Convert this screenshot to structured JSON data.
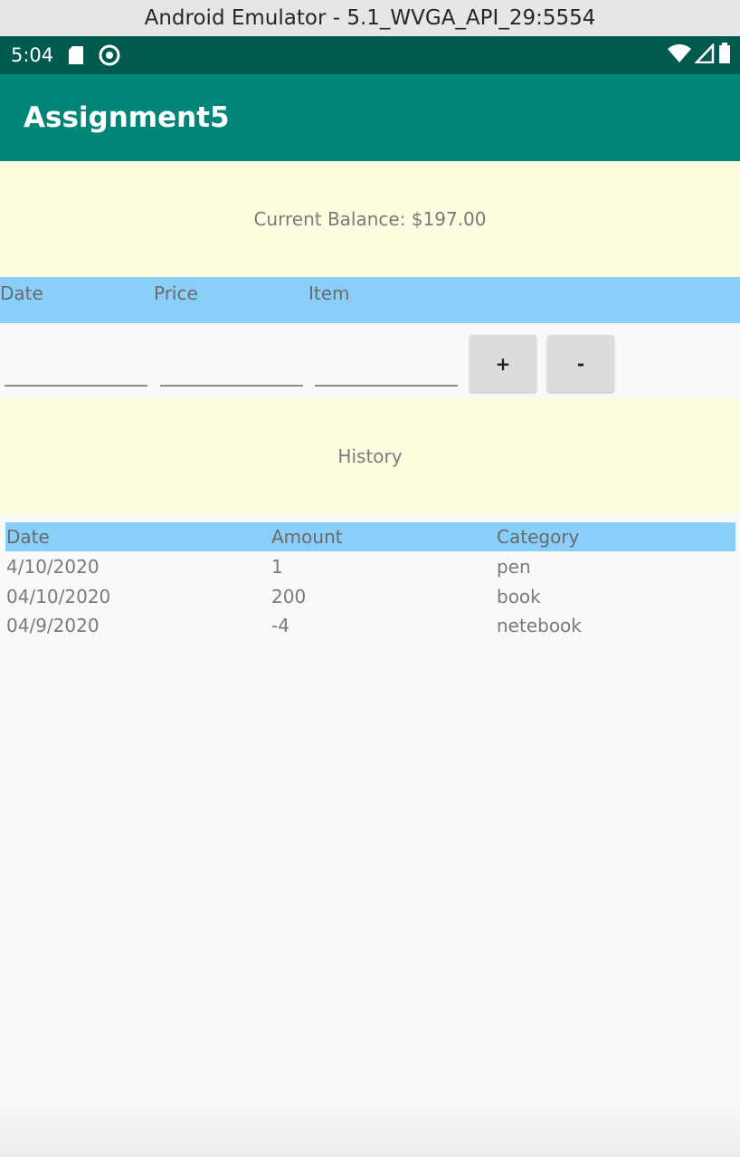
{
  "window": {
    "title": "Android Emulator - 5.1_WVGA_API_29:5554"
  },
  "status_bar": {
    "time": "5:04"
  },
  "app_bar": {
    "title": "Assignment5"
  },
  "balance": {
    "text": "Current Balance: $197.00"
  },
  "input_header": {
    "date": "Date",
    "price": "Price",
    "item": "Item"
  },
  "inputs": {
    "date": "",
    "price": "",
    "item": ""
  },
  "buttons": {
    "add": "+",
    "subtract": "-"
  },
  "history": {
    "title": "History"
  },
  "table": {
    "headers": [
      "Date",
      "Amount",
      "Category"
    ],
    "rows": [
      [
        "4/10/2020",
        "1",
        "pen"
      ],
      [
        "04/10/2020",
        "200",
        "book"
      ],
      [
        "04/9/2020",
        "-4",
        "netebook"
      ]
    ]
  },
  "colors": {
    "app_bar": "#018576",
    "status_bar": "#015a4e",
    "header_blue": "#89cffa",
    "panel_yellow": "#fffde0"
  }
}
